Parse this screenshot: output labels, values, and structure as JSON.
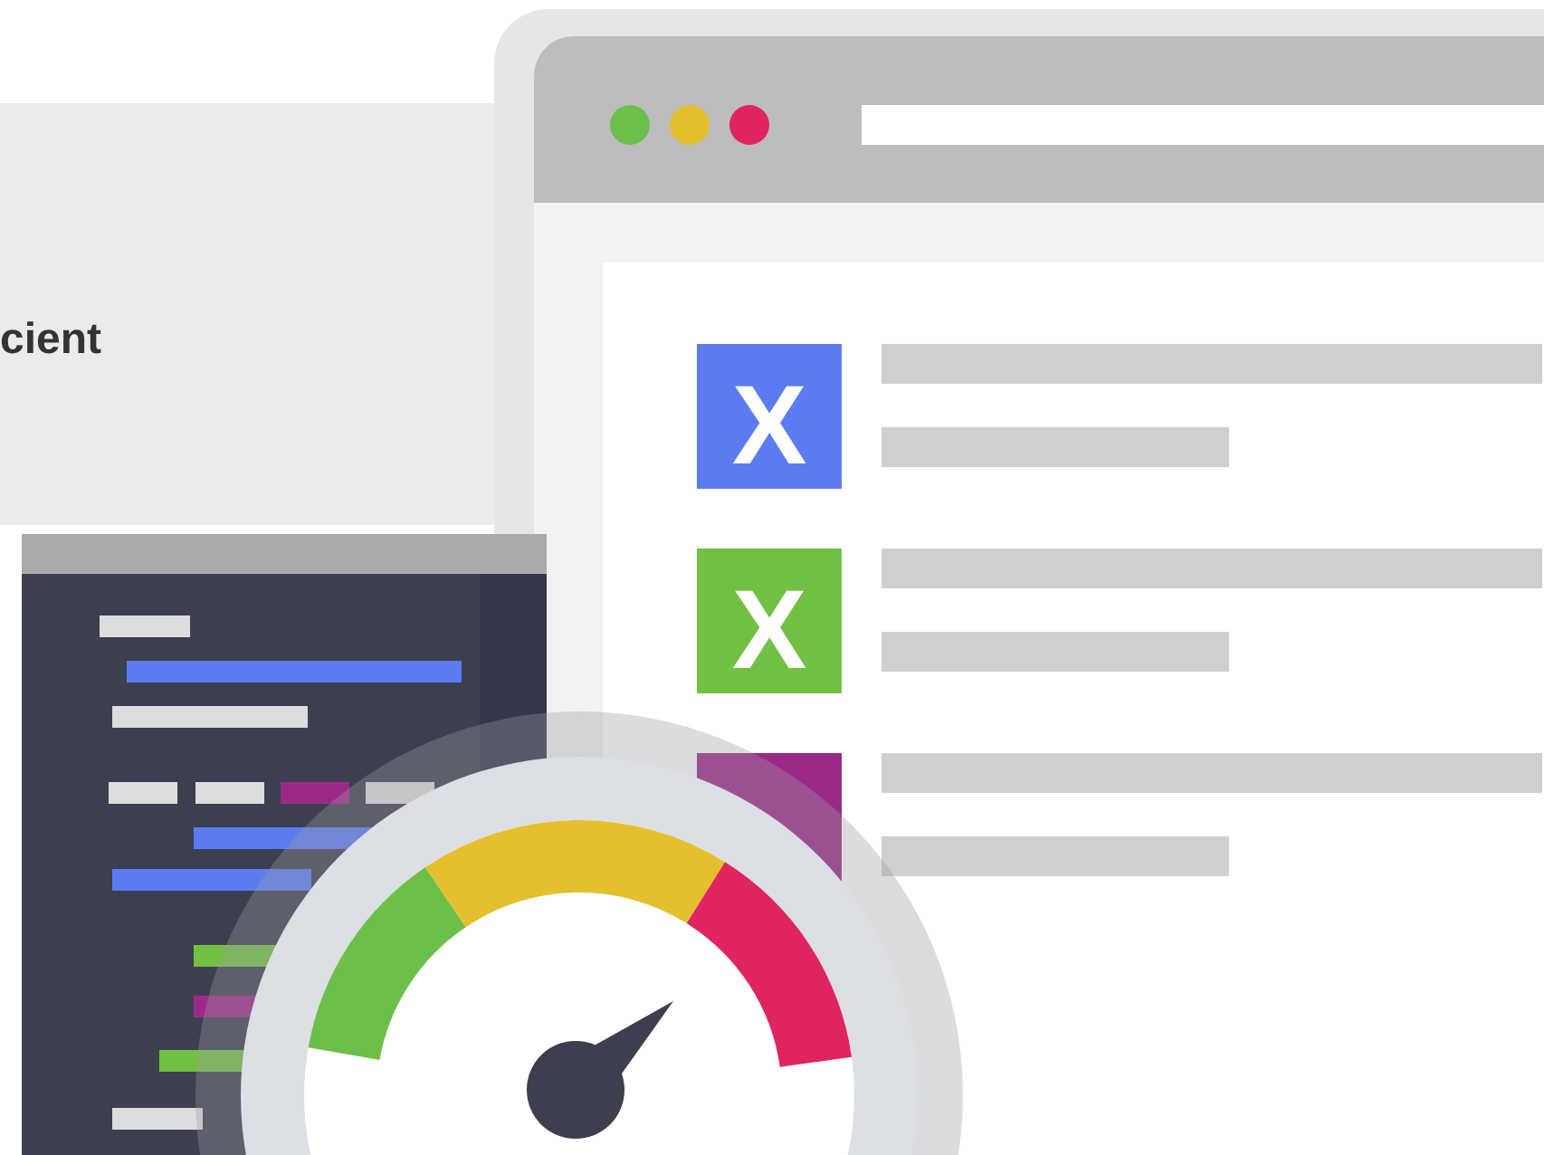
{
  "hero": {
    "heading": "cient"
  },
  "illustration": {
    "list_items": [
      {
        "letter": "X",
        "color": "#5b7cf0"
      },
      {
        "letter": "X",
        "color": "#72c043"
      },
      {
        "color": "#9b2a87"
      }
    ]
  }
}
